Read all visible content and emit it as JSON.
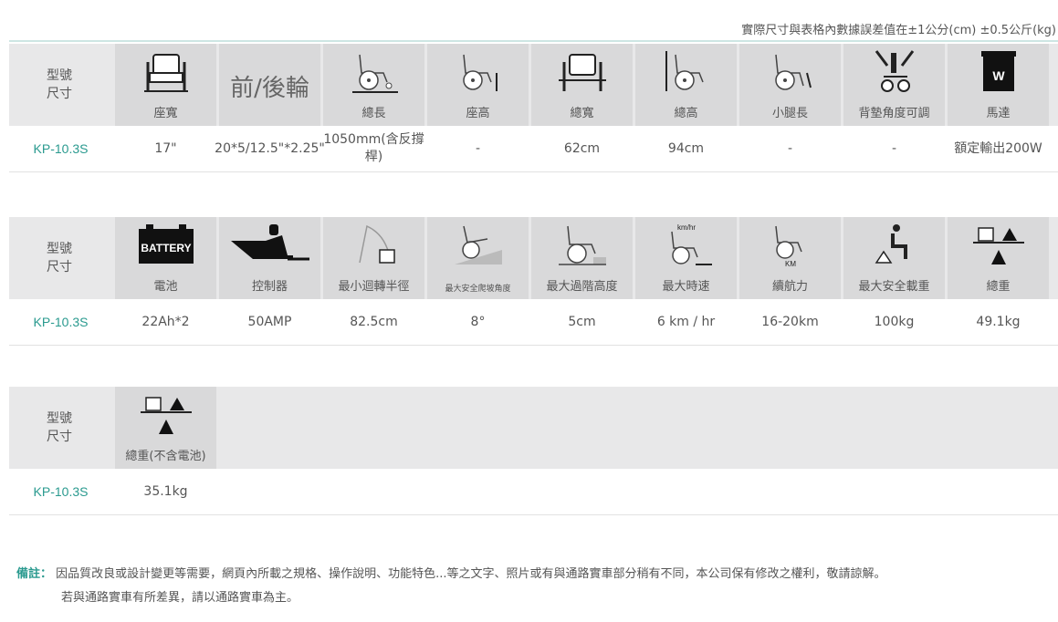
{
  "top_note": "實際尺寸與表格內數據誤差值在±1公分(cm) ±0.5公斤(kg)",
  "label_line1": "型號",
  "label_line2": "尺寸",
  "model": "KP-10.3S",
  "table1": {
    "headers": [
      {
        "icon": "seat-width-icon",
        "caption": "座寬"
      },
      {
        "icon": "",
        "big": "前/後輪",
        "caption": ""
      },
      {
        "icon": "total-length-icon",
        "caption": "總長"
      },
      {
        "icon": "seat-height-icon",
        "caption": "座高"
      },
      {
        "icon": "total-width-icon",
        "caption": "總寬"
      },
      {
        "icon": "total-height-icon",
        "caption": "總高"
      },
      {
        "icon": "leg-length-icon",
        "caption": "小腿長"
      },
      {
        "icon": "backrest-angle-icon",
        "caption": "背墊角度可調"
      },
      {
        "icon": "motor-icon",
        "caption": "馬達"
      }
    ],
    "values": [
      "17\"",
      "20*5/12.5\"*2.25\"",
      "1050mm(含反撐桿)",
      "-",
      "62cm",
      "94cm",
      "-",
      "-",
      "額定輸出200W"
    ]
  },
  "table2": {
    "headers": [
      {
        "icon": "battery-icon",
        "caption": "電池"
      },
      {
        "icon": "controller-icon",
        "caption": "控制器"
      },
      {
        "icon": "turning-radius-icon",
        "caption": "最小迴轉半徑"
      },
      {
        "icon": "slope-icon",
        "caption": "最大安全爬坡角度",
        "small": true
      },
      {
        "icon": "step-height-icon",
        "caption": "最大過階高度"
      },
      {
        "icon": "speed-icon",
        "caption": "最大時速"
      },
      {
        "icon": "range-icon",
        "caption": "續航力"
      },
      {
        "icon": "max-load-icon",
        "caption": "最大安全載重"
      },
      {
        "icon": "total-weight-icon",
        "caption": "總重"
      }
    ],
    "values": [
      "22Ah*2",
      "50AMP",
      "82.5cm",
      "8°",
      "5cm",
      "6 km / hr",
      "16-20km",
      "100kg",
      "49.1kg"
    ]
  },
  "table3": {
    "headers": [
      {
        "icon": "weight-no-battery-icon",
        "caption": "總重(不含電池)"
      }
    ],
    "values": [
      "35.1kg"
    ]
  },
  "icon_text": {
    "battery": "BATTERY",
    "motor": "W",
    "speed": "km/hr",
    "range": "KM"
  },
  "remark": {
    "key": "備註：",
    "line1": "因品質改良或設計變更等需要，網頁內所載之規格、操作說明、功能特色...等之文字、照片或有與通路實車部分稍有不同，本公司保有修改之權利，敬請諒解。",
    "line2": "若與通路實車有所差異，請以通路實車為主。"
  }
}
